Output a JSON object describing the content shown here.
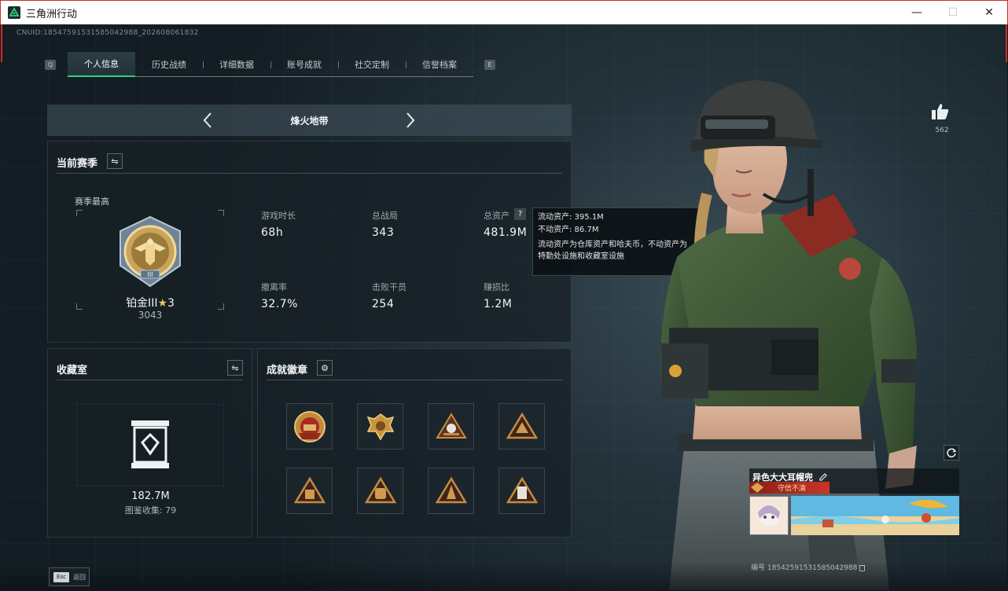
{
  "window": {
    "title": "三角洲行动",
    "minimize_glyph": "—",
    "maximize_glyph": "☐",
    "close_glyph": "✕"
  },
  "colors": {
    "accent": "#2fd07f",
    "title_badge": "#c9342a",
    "gold": "#c9a45b"
  },
  "cnuid": "CNUID:18547591531585042988_202608061832",
  "tabs": {
    "left_key": "Q",
    "right_key": "E",
    "items": [
      {
        "label": "个人信息",
        "active": true
      },
      {
        "label": "历史战绩",
        "active": false
      },
      {
        "label": "详细数据",
        "active": false
      },
      {
        "label": "账号成就",
        "active": false
      },
      {
        "label": "社交定制",
        "active": false
      },
      {
        "label": "信誉档案",
        "active": false
      }
    ]
  },
  "mode_selector": {
    "label": "烽火地带",
    "prev_icon": "chevron-left-icon",
    "next_icon": "chevron-right-icon"
  },
  "season": {
    "title": "当前赛季",
    "best_label": "赛季最高",
    "rank_name": "铂金III",
    "rank_stars": "3",
    "rank_score": "3043",
    "stats": [
      {
        "label": "游戏时长",
        "value": "68h"
      },
      {
        "label": "总战局",
        "value": "343"
      },
      {
        "label": "总资产",
        "value": "481.9M"
      },
      {
        "label": "撤离率",
        "value": "32.7%"
      },
      {
        "label": "击败干员",
        "value": "254"
      },
      {
        "label": "赚损比",
        "value": "1.2M"
      }
    ],
    "tooltip": {
      "liquid": "流动资产: 395.1M",
      "fixed": "不动资产: 86.7M",
      "note": "流动资产为仓库资产和哈夫币，不动资产为特勤处设施和收藏室设施"
    }
  },
  "collection": {
    "title": "收藏室",
    "value": "182.7M",
    "count_text": "图鉴收集: 79"
  },
  "achievements": {
    "title": "成就徽章",
    "badges": [
      "badge-1",
      "badge-2",
      "badge-3",
      "badge-4",
      "badge-5",
      "badge-6",
      "badge-7",
      "badge-8"
    ]
  },
  "likes": {
    "count": "562"
  },
  "player": {
    "name": "异色大大耳帽兜",
    "title": "守信不渝",
    "id_label": "编号",
    "id_value": "18542591531585042988"
  },
  "bottom": {
    "esc_key": "Esc",
    "back_label": "返回"
  }
}
